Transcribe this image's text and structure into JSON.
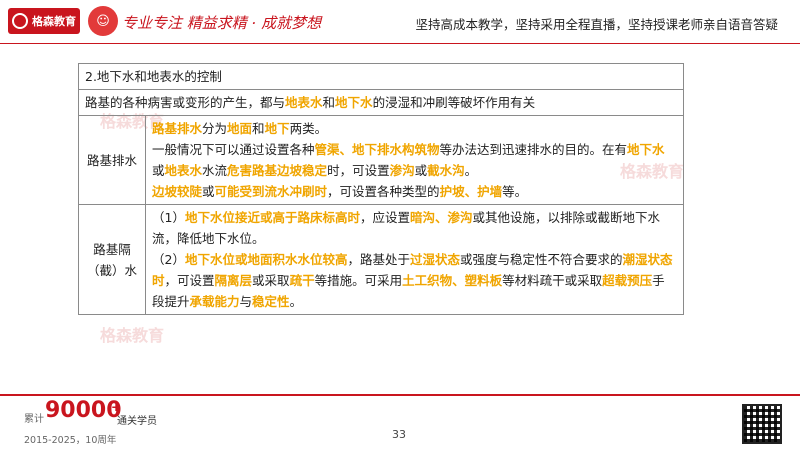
{
  "header": {
    "logo_text": "格森教育",
    "slogan": "专业专注 精益求精 · 成就梦想",
    "motto": "坚持高成本教学，坚持采用全程直播，坚持授课老师亲自语音答疑"
  },
  "watermark": "格森教育",
  "table": {
    "title": "2.地下水和地表水的控制",
    "intro": [
      "路基的各种病害或变形的产生，都与",
      "地表水",
      "和",
      "地下水",
      "的浸湿和冲刷等破坏作用有关"
    ],
    "drainage": {
      "label": "路基排水",
      "lines": [
        [
          "路基排水",
          "分为",
          "地面",
          "和",
          "地下",
          "两类。"
        ],
        [
          "一般情况下可以通过设置各种",
          "管渠、地下排水构筑物",
          "等办法达到迅速排水的目的。在有",
          "地下水",
          "或",
          "地表水",
          "水流",
          "危害路基边坡稳定",
          "时，可设置",
          "渗沟",
          "或",
          "截水沟",
          "。"
        ],
        [
          "边坡较陡",
          "或",
          "可能受到流水冲刷时",
          "，可设置各种类型的",
          "护坡、护墙",
          "等。"
        ]
      ]
    },
    "isolation": {
      "label1": "路基隔",
      "label2": "（截）水",
      "p1": [
        "（1）",
        "地下水位接近或高于路床标高时",
        "，应设置",
        "暗沟、渗沟",
        "或其他设施，以排除或截断地下水流，降低地下水位。"
      ],
      "p2": [
        "（2）",
        "地下水位或地面积水水位较高",
        "，路基处于",
        "过湿状态",
        "或强度与稳定性不符合要求的",
        "潮湿状态时",
        "，可设置",
        "隔离层",
        "或采取",
        "疏干",
        "等措施。可采用",
        "土工织物、塑料板",
        "等材料疏干或采取",
        "超载预压",
        "手段提升",
        "承载能力",
        "与",
        "稳定性",
        "。"
      ]
    }
  },
  "footer": {
    "leiji": "累计",
    "number": "90000",
    "plus": "+",
    "tongguan": "通关学员",
    "years": "2015-2025，10周年",
    "page": "33"
  }
}
